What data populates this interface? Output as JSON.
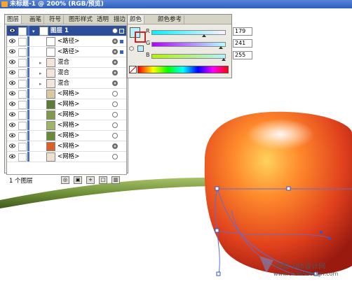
{
  "window": {
    "title": "未标题-1 @ 200% (RGB/预览)"
  },
  "layers_panel": {
    "tabs": [
      "图层",
      "画笔",
      "符号",
      "图形样式",
      "透明度",
      "描边"
    ],
    "rows": [
      {
        "label": "图层 1",
        "selected": true,
        "expand": "▾"
      },
      {
        "label": "<路径>",
        "expand": ""
      },
      {
        "label": "<路径>",
        "expand": ""
      },
      {
        "label": "混合",
        "expand": "▸"
      },
      {
        "label": "混合",
        "expand": "▸"
      },
      {
        "label": "混合",
        "expand": "▸"
      },
      {
        "label": "<网格>",
        "expand": ""
      },
      {
        "label": "<网格>",
        "expand": ""
      },
      {
        "label": "<网格>",
        "expand": ""
      },
      {
        "label": "<网格>",
        "expand": ""
      },
      {
        "label": "<网格>",
        "expand": ""
      },
      {
        "label": "<网格>",
        "expand": ""
      },
      {
        "label": "<网格>",
        "expand": ""
      }
    ],
    "footer": {
      "count": "1 个图层"
    }
  },
  "color_panel": {
    "tabs": [
      "颜色",
      "颜色参考"
    ],
    "channels": [
      {
        "name": "R",
        "value": "179"
      },
      {
        "name": "G",
        "value": "241"
      },
      {
        "name": "B",
        "value": "255"
      }
    ],
    "fill_color": "#b3f1ff"
  },
  "watermark": {
    "line1": "中国 365设计网",
    "line2": "www.cn365design.com"
  }
}
